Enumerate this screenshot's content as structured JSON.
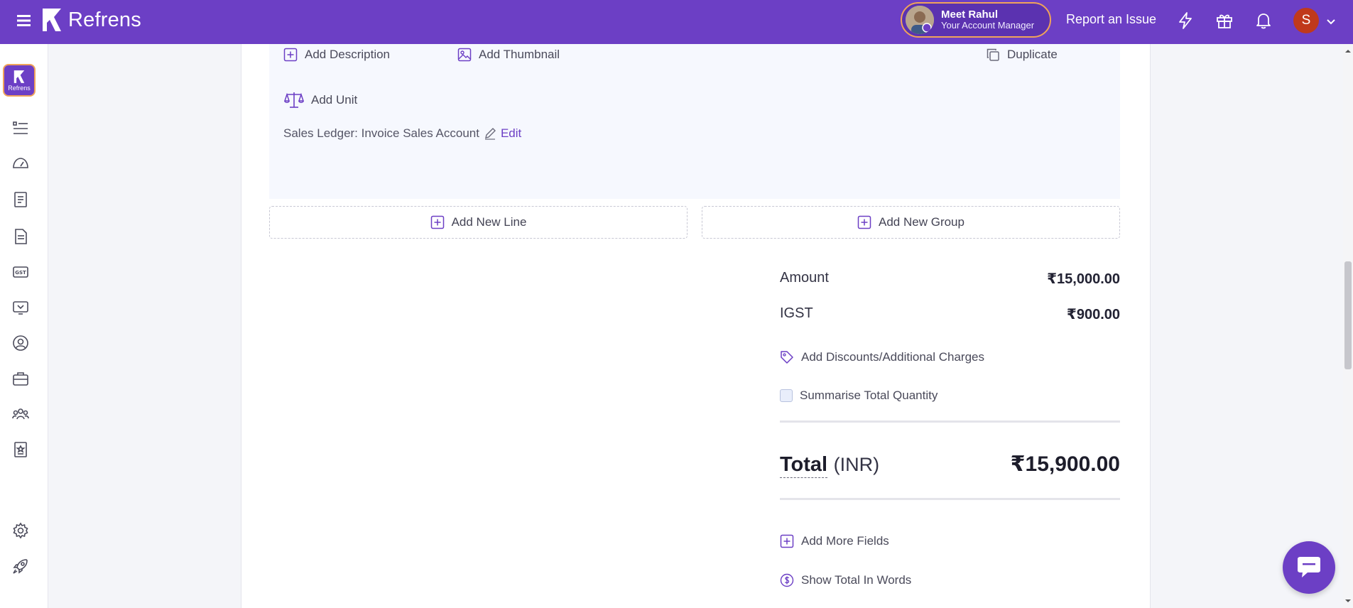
{
  "topbar": {
    "brand": "Refrens",
    "account_manager": {
      "name": "Meet Rahul",
      "role": "Your Account Manager"
    },
    "report_issue": "Report an Issue",
    "user_initial": "S",
    "accent": "#6c3fc5"
  },
  "sidebar": {
    "logo_text": "Refrens",
    "items": [
      "list-icon",
      "dashboard-icon",
      "invoice-icon",
      "document-icon",
      "gst-icon",
      "payment-icon",
      "customer-icon",
      "briefcase-icon",
      "team-icon",
      "badge-icon",
      "settings-icon",
      "rocket-icon"
    ],
    "gst_label": "GST"
  },
  "item_actions": {
    "add_description": "Add Description",
    "add_thumbnail": "Add Thumbnail",
    "duplicate": "Duplicate",
    "add_unit": "Add Unit",
    "sales_ledger": "Sales Ledger: Invoice Sales Account",
    "edit": "Edit"
  },
  "buttons": {
    "add_new_line": "Add New Line",
    "add_new_group": "Add New Group"
  },
  "summary": {
    "amount_label": "Amount",
    "amount_value": "₹15,000.00",
    "igst_label": "IGST",
    "igst_value": "₹900.00",
    "discounts": "Add Discounts/Additional Charges",
    "summarise_qty": "Summarise Total Quantity",
    "total_label": "Total",
    "total_currency": "(INR)",
    "total_value": "₹15,900.00",
    "add_more_fields": "Add More Fields",
    "show_total_words": "Show Total In Words"
  }
}
